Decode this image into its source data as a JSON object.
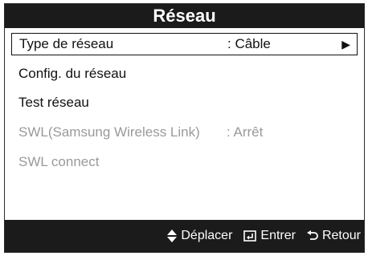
{
  "title": "Réseau",
  "menu": {
    "items": [
      {
        "label": "Type de réseau",
        "value": ": Câble",
        "arrow": "▶",
        "selected": true,
        "enabled": true
      },
      {
        "label": "Config. du réseau",
        "value": "",
        "arrow": "",
        "selected": false,
        "enabled": true
      },
      {
        "label": "Test réseau",
        "value": "",
        "arrow": "",
        "selected": false,
        "enabled": true
      },
      {
        "label": "SWL(Samsung Wireless Link)",
        "value": ": Arrêt",
        "arrow": "",
        "selected": false,
        "enabled": false
      },
      {
        "label": "SWL connect",
        "value": "",
        "arrow": "",
        "selected": false,
        "enabled": false
      }
    ]
  },
  "footer": {
    "move_icon": "up-down-icon",
    "move_label": "Déplacer",
    "enter_icon": "enter-icon",
    "enter_label": "Entrer",
    "return_icon": "return-icon",
    "return_label": "Retour"
  },
  "colors": {
    "bar_background": "#1b1b1b",
    "text": "#111111",
    "disabled_text": "#9a9a9a"
  }
}
